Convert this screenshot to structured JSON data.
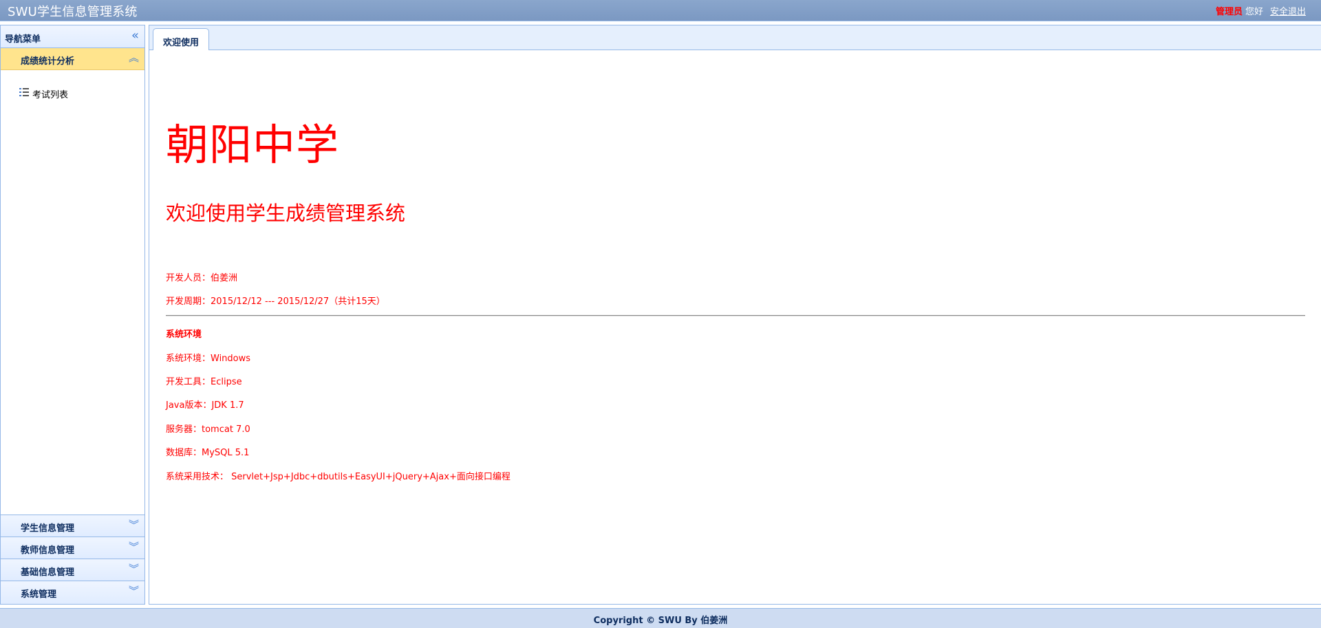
{
  "header": {
    "title": "SWU学生信息管理系统",
    "role": "管理员",
    "greeting": "您好",
    "logout_label": "安全退出"
  },
  "sidebar": {
    "title": "导航菜单",
    "collapse_icon": "double-chevron-left-icon",
    "active_panel": {
      "label": "成绩统计分析",
      "items": [
        {
          "label": "考试列表",
          "icon": "list-icon"
        }
      ]
    },
    "panels": [
      {
        "label": "学生信息管理"
      },
      {
        "label": "教师信息管理"
      },
      {
        "label": "基础信息管理"
      },
      {
        "label": "系统管理"
      }
    ]
  },
  "tabs": [
    {
      "label": "欢迎使用",
      "active": true
    }
  ],
  "content": {
    "school_name": "朝阳中学",
    "welcome": "欢迎使用学生成绩管理系统",
    "developer": "开发人员：伯姜洲",
    "period": "开发周期：2015/12/12 --- 2015/12/27（共计15天）",
    "env_heading": "系统环境",
    "env": [
      "系统环境：Windows",
      "开发工具：Eclipse",
      "Java版本：JDK 1.7",
      "服务器：tomcat 7.0",
      "数据库：MySQL 5.1",
      "系统采用技术： Servlet+Jsp+Jdbc+dbutils+EasyUI+jQuery+Ajax+面向接口编程"
    ]
  },
  "footer": {
    "copyright": "Copyright © SWU By 伯姜洲"
  },
  "colors": {
    "accent_red": "#ff0000",
    "header_blue": "#7b98c2",
    "border_blue": "#95b8e7",
    "active_panel": "#ffe48d"
  }
}
